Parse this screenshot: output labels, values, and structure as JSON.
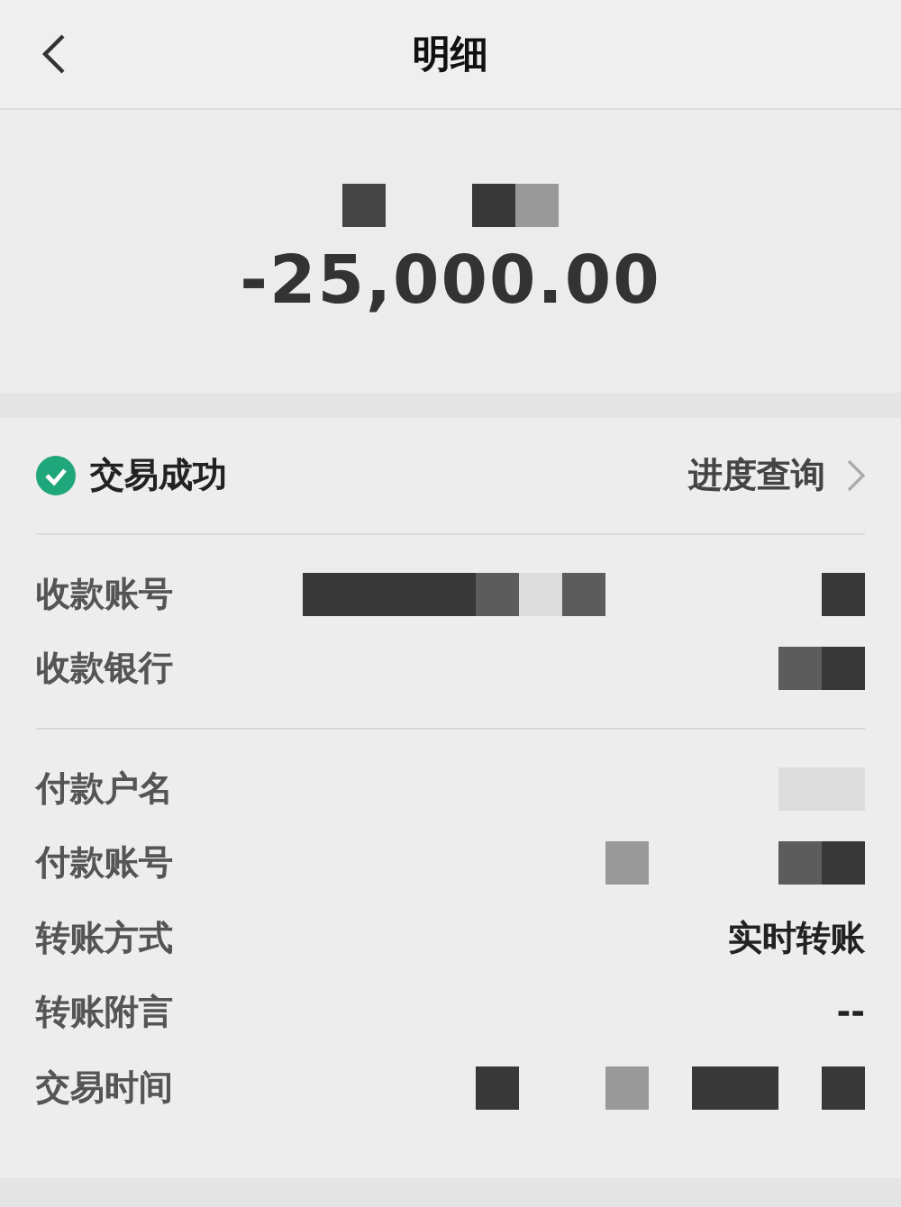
{
  "header": {
    "title": "明细"
  },
  "summary": {
    "payee_redacted": true,
    "amount": "-25,000.00"
  },
  "status": {
    "label": "交易成功",
    "success": true,
    "link": "进度查询"
  },
  "groups": [
    {
      "rows": [
        {
          "label": "收款账号",
          "redacted": true
        },
        {
          "label": "收款银行",
          "redacted": true
        }
      ]
    },
    {
      "rows": [
        {
          "label": "付款户名",
          "redacted": true
        },
        {
          "label": "付款账号",
          "redacted": true
        },
        {
          "label": "转账方式",
          "value": "实时转账"
        },
        {
          "label": "转账附言",
          "value": "--"
        },
        {
          "label": "交易时间",
          "redacted": true
        }
      ]
    }
  ]
}
